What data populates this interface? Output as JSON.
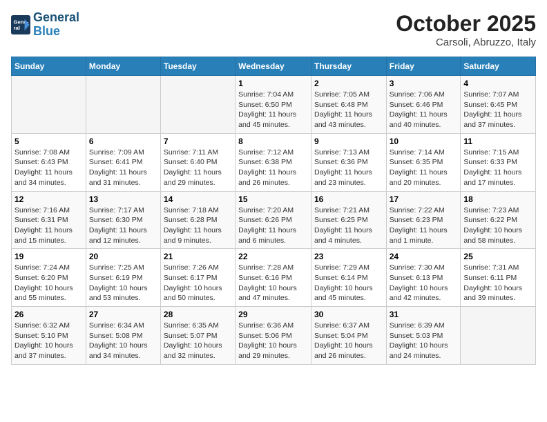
{
  "header": {
    "logo_line1": "General",
    "logo_line2": "Blue",
    "month": "October 2025",
    "location": "Carsoli, Abruzzo, Italy"
  },
  "weekdays": [
    "Sunday",
    "Monday",
    "Tuesday",
    "Wednesday",
    "Thursday",
    "Friday",
    "Saturday"
  ],
  "weeks": [
    [
      {
        "day": "",
        "info": ""
      },
      {
        "day": "",
        "info": ""
      },
      {
        "day": "",
        "info": ""
      },
      {
        "day": "1",
        "info": "Sunrise: 7:04 AM\nSunset: 6:50 PM\nDaylight: 11 hours and 45 minutes."
      },
      {
        "day": "2",
        "info": "Sunrise: 7:05 AM\nSunset: 6:48 PM\nDaylight: 11 hours and 43 minutes."
      },
      {
        "day": "3",
        "info": "Sunrise: 7:06 AM\nSunset: 6:46 PM\nDaylight: 11 hours and 40 minutes."
      },
      {
        "day": "4",
        "info": "Sunrise: 7:07 AM\nSunset: 6:45 PM\nDaylight: 11 hours and 37 minutes."
      }
    ],
    [
      {
        "day": "5",
        "info": "Sunrise: 7:08 AM\nSunset: 6:43 PM\nDaylight: 11 hours and 34 minutes."
      },
      {
        "day": "6",
        "info": "Sunrise: 7:09 AM\nSunset: 6:41 PM\nDaylight: 11 hours and 31 minutes."
      },
      {
        "day": "7",
        "info": "Sunrise: 7:11 AM\nSunset: 6:40 PM\nDaylight: 11 hours and 29 minutes."
      },
      {
        "day": "8",
        "info": "Sunrise: 7:12 AM\nSunset: 6:38 PM\nDaylight: 11 hours and 26 minutes."
      },
      {
        "day": "9",
        "info": "Sunrise: 7:13 AM\nSunset: 6:36 PM\nDaylight: 11 hours and 23 minutes."
      },
      {
        "day": "10",
        "info": "Sunrise: 7:14 AM\nSunset: 6:35 PM\nDaylight: 11 hours and 20 minutes."
      },
      {
        "day": "11",
        "info": "Sunrise: 7:15 AM\nSunset: 6:33 PM\nDaylight: 11 hours and 17 minutes."
      }
    ],
    [
      {
        "day": "12",
        "info": "Sunrise: 7:16 AM\nSunset: 6:31 PM\nDaylight: 11 hours and 15 minutes."
      },
      {
        "day": "13",
        "info": "Sunrise: 7:17 AM\nSunset: 6:30 PM\nDaylight: 11 hours and 12 minutes."
      },
      {
        "day": "14",
        "info": "Sunrise: 7:18 AM\nSunset: 6:28 PM\nDaylight: 11 hours and 9 minutes."
      },
      {
        "day": "15",
        "info": "Sunrise: 7:20 AM\nSunset: 6:26 PM\nDaylight: 11 hours and 6 minutes."
      },
      {
        "day": "16",
        "info": "Sunrise: 7:21 AM\nSunset: 6:25 PM\nDaylight: 11 hours and 4 minutes."
      },
      {
        "day": "17",
        "info": "Sunrise: 7:22 AM\nSunset: 6:23 PM\nDaylight: 11 hours and 1 minute."
      },
      {
        "day": "18",
        "info": "Sunrise: 7:23 AM\nSunset: 6:22 PM\nDaylight: 10 hours and 58 minutes."
      }
    ],
    [
      {
        "day": "19",
        "info": "Sunrise: 7:24 AM\nSunset: 6:20 PM\nDaylight: 10 hours and 55 minutes."
      },
      {
        "day": "20",
        "info": "Sunrise: 7:25 AM\nSunset: 6:19 PM\nDaylight: 10 hours and 53 minutes."
      },
      {
        "day": "21",
        "info": "Sunrise: 7:26 AM\nSunset: 6:17 PM\nDaylight: 10 hours and 50 minutes."
      },
      {
        "day": "22",
        "info": "Sunrise: 7:28 AM\nSunset: 6:16 PM\nDaylight: 10 hours and 47 minutes."
      },
      {
        "day": "23",
        "info": "Sunrise: 7:29 AM\nSunset: 6:14 PM\nDaylight: 10 hours and 45 minutes."
      },
      {
        "day": "24",
        "info": "Sunrise: 7:30 AM\nSunset: 6:13 PM\nDaylight: 10 hours and 42 minutes."
      },
      {
        "day": "25",
        "info": "Sunrise: 7:31 AM\nSunset: 6:11 PM\nDaylight: 10 hours and 39 minutes."
      }
    ],
    [
      {
        "day": "26",
        "info": "Sunrise: 6:32 AM\nSunset: 5:10 PM\nDaylight: 10 hours and 37 minutes."
      },
      {
        "day": "27",
        "info": "Sunrise: 6:34 AM\nSunset: 5:08 PM\nDaylight: 10 hours and 34 minutes."
      },
      {
        "day": "28",
        "info": "Sunrise: 6:35 AM\nSunset: 5:07 PM\nDaylight: 10 hours and 32 minutes."
      },
      {
        "day": "29",
        "info": "Sunrise: 6:36 AM\nSunset: 5:06 PM\nDaylight: 10 hours and 29 minutes."
      },
      {
        "day": "30",
        "info": "Sunrise: 6:37 AM\nSunset: 5:04 PM\nDaylight: 10 hours and 26 minutes."
      },
      {
        "day": "31",
        "info": "Sunrise: 6:39 AM\nSunset: 5:03 PM\nDaylight: 10 hours and 24 minutes."
      },
      {
        "day": "",
        "info": ""
      }
    ]
  ]
}
